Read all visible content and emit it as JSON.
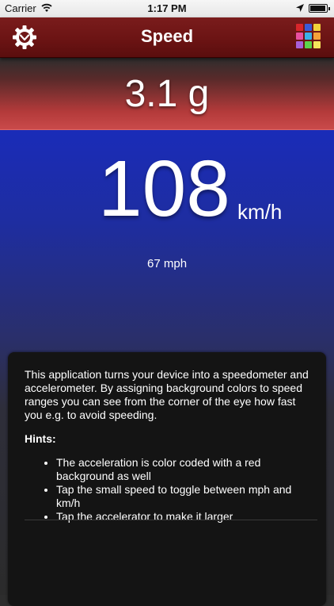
{
  "status_bar": {
    "carrier": "Carrier",
    "time": "1:17 PM"
  },
  "nav": {
    "title": "Speed",
    "settings_icon": "gear-icon",
    "color_icon": "color-grid-icon",
    "color_grid": [
      "#d8262b",
      "#3a5bd8",
      "#f0d23a",
      "#e84fa0",
      "#3ab0e8",
      "#f4a23a",
      "#a860d8",
      "#5bd44a",
      "#f4e45a"
    ]
  },
  "acceleration": {
    "value": "3.1 g",
    "color": "#c94a4a"
  },
  "speed": {
    "value": "108",
    "unit": "km/h",
    "secondary": "67 mph",
    "color": "#1a2cb8"
  },
  "info": {
    "description": "This application turns your device into a speedometer and accelerometer. By assigning background colors to speed ranges you can see from the corner of the eye how fast you e.g. to avoid speeding.",
    "hints_title": "Hints:",
    "hints": [
      "The acceleration is color coded with a red background as well",
      "Tap the small speed to toggle between mph and km/h",
      "Tap the accelerator to make it larger"
    ]
  }
}
